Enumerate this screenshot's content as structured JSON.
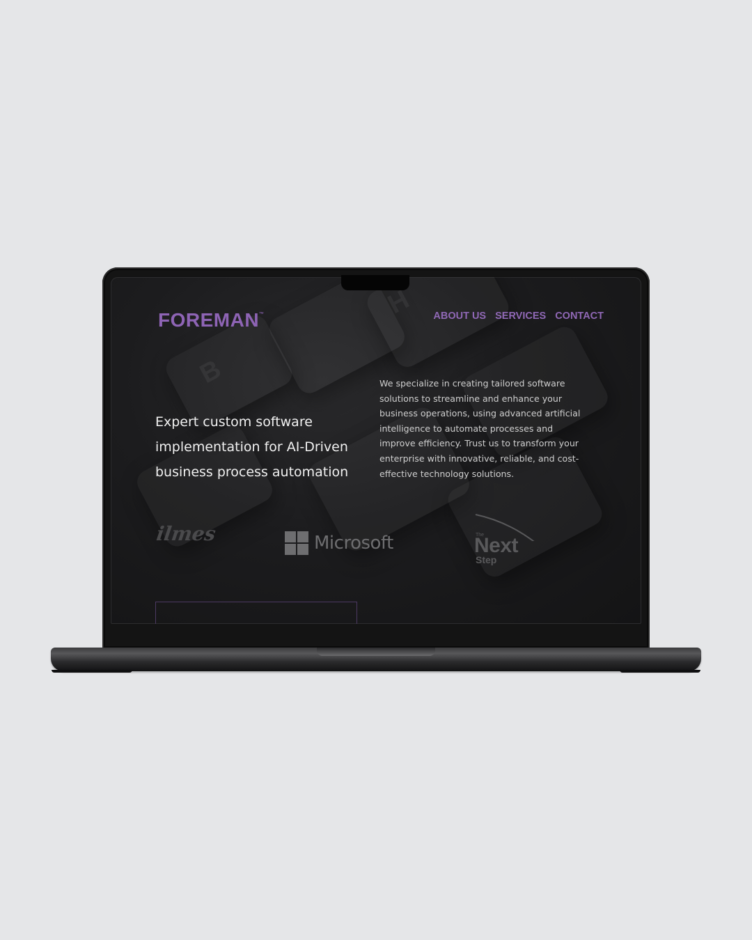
{
  "brand": {
    "name": "FOREMAN",
    "trademark": "™",
    "color": "#8e64b5"
  },
  "nav": {
    "items": [
      "ABOUT US",
      "SERVICES",
      "CONTACT"
    ]
  },
  "hero": {
    "headline_lines": [
      "Expert custom software",
      "implementation for AI-Driven",
      "business process automation"
    ],
    "description_lines": [
      "We specialize in creating tailored software",
      "solutions to streamline and enhance your",
      "business operations, using advanced artificial",
      "intelligence to automate processes and",
      "improve efficiency. Trust us to transform your",
      "enterprise with innovative, reliable, and cost-",
      "effective technology solutions."
    ]
  },
  "clients": {
    "quilmes": "ilmes",
    "microsoft": "Microsoft",
    "nextstep": {
      "the": "The",
      "next": "Next",
      "step": "Step"
    }
  },
  "background_keys": [
    "B",
    "H"
  ],
  "icons": {
    "microsoft": "windows-logo-icon"
  }
}
